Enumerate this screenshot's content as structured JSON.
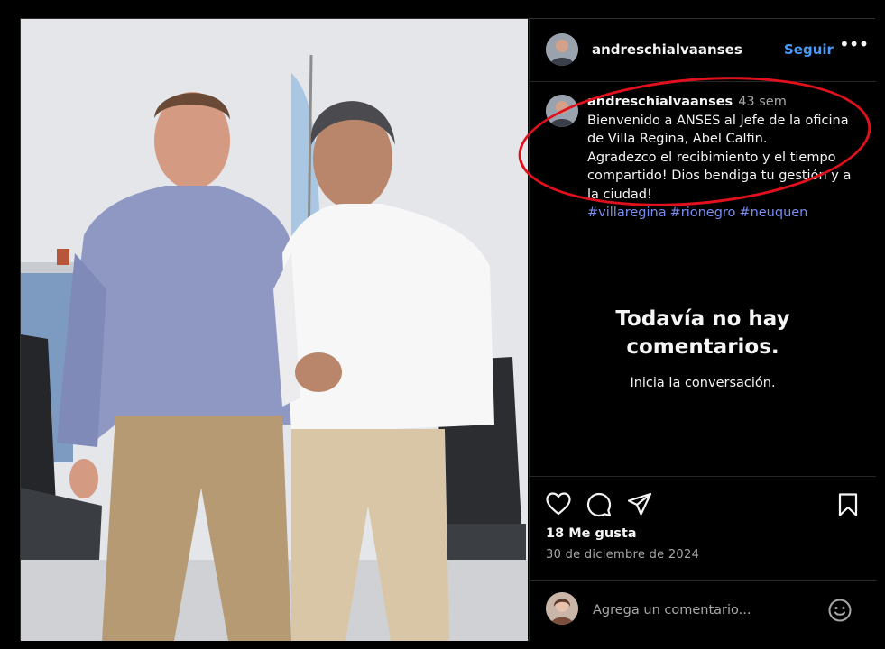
{
  "post": {
    "username": "andreschialvaanses",
    "follow_label": "Seguir",
    "more_label": "•••"
  },
  "caption": {
    "username": "andreschialvaanses",
    "time": "43 sem",
    "lines": [
      "Bienvenido a ANSES al Jefe de la oficina",
      "de Villa Regina, Abel Calfin.",
      "Agradezco el recibimiento y el tiempo",
      "compartido! Dios bendiga tu gestión y a",
      "la ciudad!"
    ],
    "hashtags": [
      "#villaregina",
      "#rionegro",
      "#neuquen"
    ]
  },
  "comments": {
    "empty_title_1": "Todavía no hay",
    "empty_title_2": "comentarios.",
    "empty_subtitle": "Inicia la conversación."
  },
  "engagement": {
    "likes": "18 Me gusta",
    "date": "30 de diciembre de 2024"
  },
  "add_comment": {
    "placeholder": "Agrega un comentario..."
  },
  "icons": {
    "like": "heart-icon",
    "comment": "comment-icon",
    "share": "share-icon",
    "save": "bookmark-icon",
    "emoji": "emoji-icon",
    "more": "more-icon"
  },
  "colors": {
    "background": "#000000",
    "link_blue": "#4a9bf7",
    "hashtag": "#7b8cf0",
    "muted": "#a8a8a8",
    "annotation_red": "#e0101c"
  }
}
